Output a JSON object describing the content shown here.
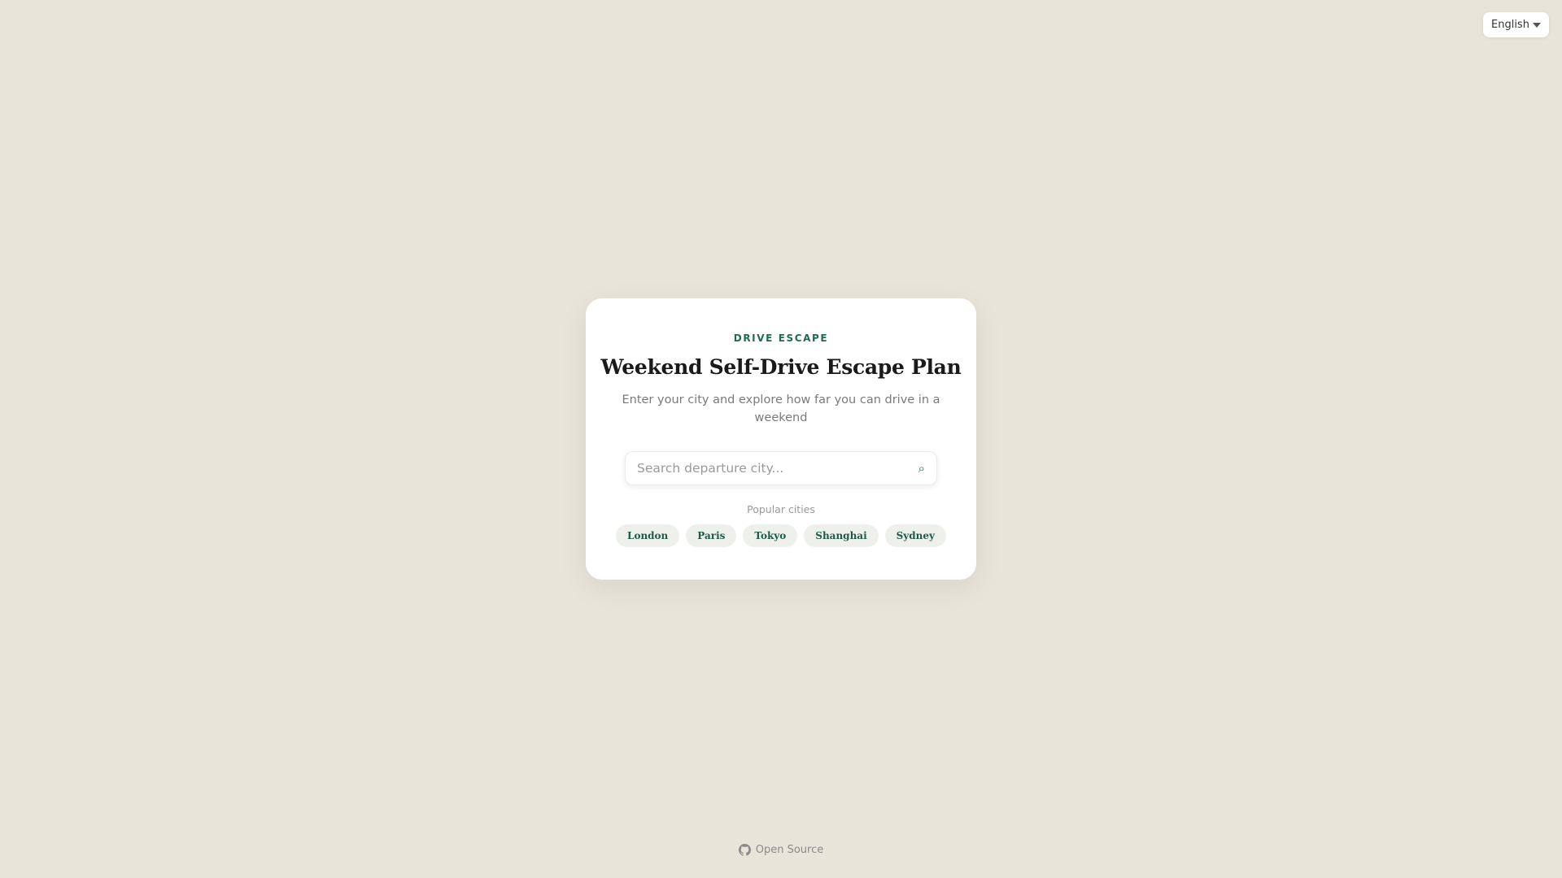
{
  "language": {
    "selected": "English"
  },
  "hero": {
    "eyebrow": "DRIVE ESCAPE",
    "title": "Weekend Self-Drive Escape Plan",
    "subtitle": "Enter your city and explore how far you can drive in a weekend"
  },
  "search": {
    "placeholder": "Search departure city...",
    "value": "",
    "icon": "search-icon"
  },
  "popular": {
    "label": "Popular cities",
    "cities": [
      "London",
      "Paris",
      "Tokyo",
      "Shanghai",
      "Sydney"
    ]
  },
  "footer": {
    "link_label": "Open Source",
    "icon": "github-icon"
  },
  "colors": {
    "background": "#e8e4d9",
    "accent": "#1e6b55",
    "card": "#ffffff",
    "chip_bg": "#eef0ec"
  }
}
